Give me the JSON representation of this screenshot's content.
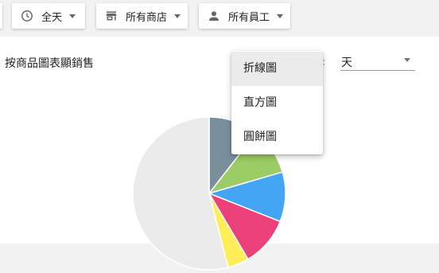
{
  "filters": {
    "time": {
      "label": "全天",
      "icon": "clock-icon"
    },
    "store": {
      "label": "所有商店",
      "icon": "store-icon"
    },
    "staff": {
      "label": "所有員工",
      "icon": "person-icon"
    }
  },
  "report": {
    "title": "按商品圖表顯銷售",
    "range_select": {
      "value": "天"
    }
  },
  "chart_type_menu": {
    "options": [
      "折線圖",
      "直方圖",
      "圓餅圖"
    ],
    "highlighted": "折線圖"
  },
  "chart_data": {
    "type": "pie",
    "slices": [
      {
        "value": 10.5,
        "color": "#78909c"
      },
      {
        "value": 10.0,
        "color": "#9ccc65"
      },
      {
        "value": 10.5,
        "color": "#42a5f5"
      },
      {
        "value": 10.5,
        "color": "#ec407a"
      },
      {
        "value": 4.5,
        "color": "#ffee58"
      },
      {
        "value": 54.0,
        "color": "#ebebeb"
      }
    ]
  }
}
